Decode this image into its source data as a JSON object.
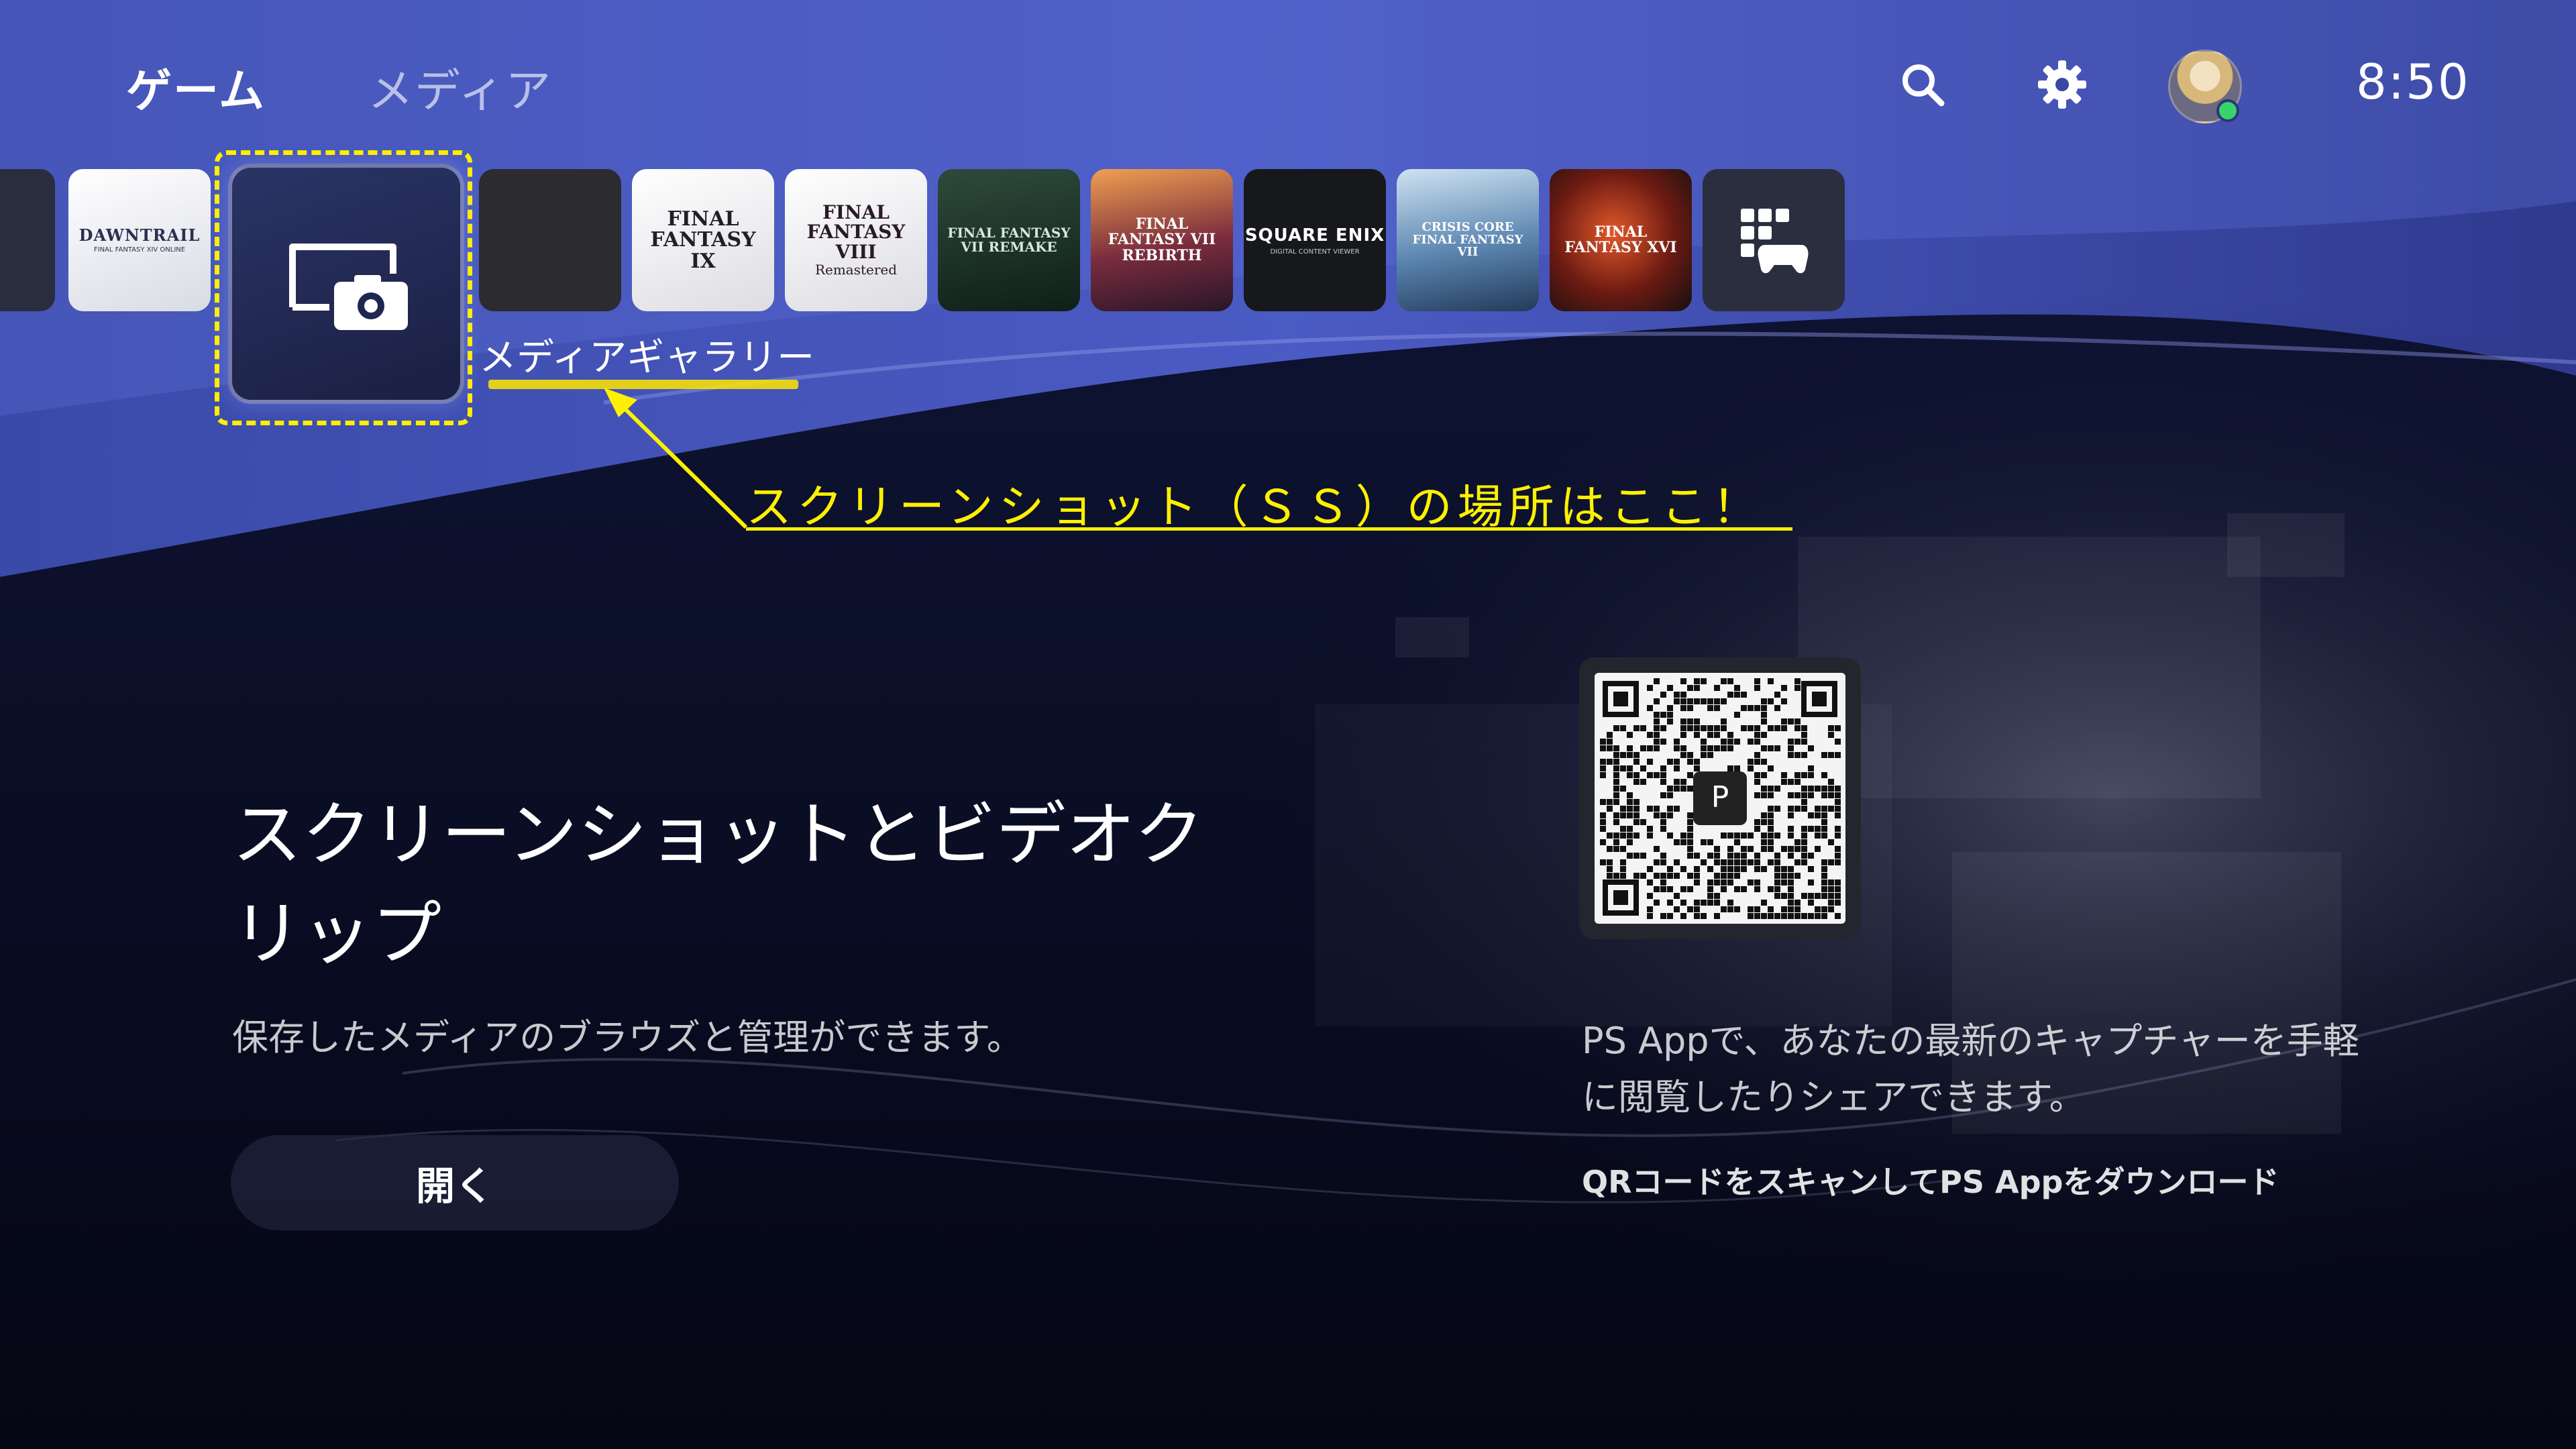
{
  "nav": {
    "tabs": [
      {
        "label": "ゲーム",
        "active": true
      },
      {
        "label": "メディア",
        "active": false
      }
    ],
    "icons": [
      "search-icon",
      "gear-icon",
      "avatar"
    ],
    "clock": "8:50"
  },
  "tiles": [
    {
      "name": "partial-tile",
      "label": ""
    },
    {
      "name": "dawntrail",
      "label": "DAWNTRAIL",
      "sub": "FINAL FANTASY XIV ONLINE"
    },
    {
      "name": "media-gallery",
      "label": "",
      "selected": true
    },
    {
      "name": "blank-tile",
      "label": ""
    },
    {
      "name": "ff9",
      "label": "FINAL FANTASY IX"
    },
    {
      "name": "ff8",
      "label": "FINAL FANTASY VIII",
      "sub": "Remastered"
    },
    {
      "name": "ff7-remake",
      "label": "FINAL FANTASY VII REMAKE"
    },
    {
      "name": "ff7-rebirth",
      "label": "FINAL FANTASY VII REBIRTH"
    },
    {
      "name": "square-enix-viewer",
      "label": "SQUARE ENIX",
      "sub": "DIGITAL CONTENT VIEWER"
    },
    {
      "name": "crisis-core",
      "label": "CRISIS CORE FINAL FANTASY VII"
    },
    {
      "name": "ff16",
      "label": "FINAL FANTASY XVI"
    },
    {
      "name": "game-library",
      "label": ""
    }
  ],
  "selected_tile_caption": "メディアギャラリー",
  "annotation": "スクリーンショット（ＳＳ）の場所はここ！",
  "main": {
    "title": "スクリーンショットとビデオクリップ",
    "description": "保存したメディアのブラウズと管理ができます。",
    "open_button": "開く"
  },
  "app_panel": {
    "description": "PS Appで、あなたの最新のキャプチャーを手軽に閲覧したりシェアできます。",
    "link": "QRコードをスキャンしてPS Appをダウンロード"
  },
  "colors": {
    "annotation": "#fff000",
    "accent_wave": "#5563c8",
    "background": "#0a0e22"
  }
}
